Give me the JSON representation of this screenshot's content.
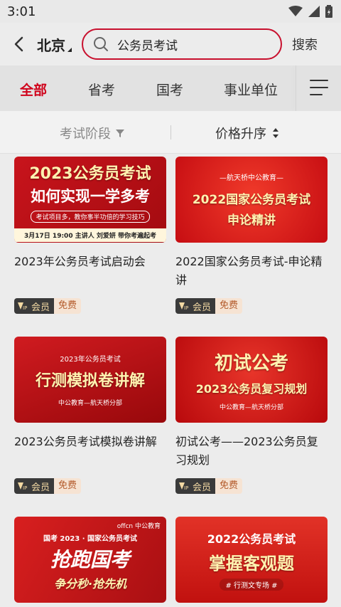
{
  "status": {
    "time": "3:01"
  },
  "header": {
    "city": "北京",
    "search_value": "公务员考试",
    "search_button": "搜索"
  },
  "tabs": [
    {
      "label": "全部",
      "active": true
    },
    {
      "label": "省考",
      "active": false
    },
    {
      "label": "国考",
      "active": false
    },
    {
      "label": "事业单位",
      "active": false
    }
  ],
  "filters": {
    "stage": "考试阶段",
    "sort": "价格升序"
  },
  "badges": {
    "vip": "会员",
    "free": "免费"
  },
  "courses": [
    {
      "title": "2023年公务员考试启动会",
      "banner": {
        "line1": "2023公务员考试",
        "line2": "如何实现一学多考",
        "line3": "考试项目多，教你事半功倍的学习技巧",
        "line4": "3月17日 19:00 主讲人 刘爱妍 带你考遍起考"
      }
    },
    {
      "title": "2022国家公务员考试-申论精讲",
      "banner": {
        "line1": "—航天桥中公教育—",
        "line2": "2022国家公务员考试",
        "line3": "申论精讲"
      }
    },
    {
      "title": "2023公务员考试模拟卷讲解",
      "banner": {
        "line1": "2023年公务员考试",
        "line2": "行测模拟卷讲解",
        "line3": "中公教育—航天桥分部"
      }
    },
    {
      "title": "初试公考——2023公务员复习规划",
      "banner": {
        "line1": "初试公考",
        "line2": "2023公务员复习规划",
        "line3": "中公教育—航天桥分部"
      }
    },
    {
      "title": "",
      "banner": {
        "line1": "国考 2023 · 国家公务员考试",
        "line2": "抢跑国考",
        "line3": "争分秒·抢先机",
        "brand": "offcn 中公教育"
      }
    },
    {
      "title": "",
      "banner": {
        "line1": "2022公务员考试",
        "line2": "掌握客观题",
        "line3": "# 行测文专场 #"
      }
    }
  ]
}
